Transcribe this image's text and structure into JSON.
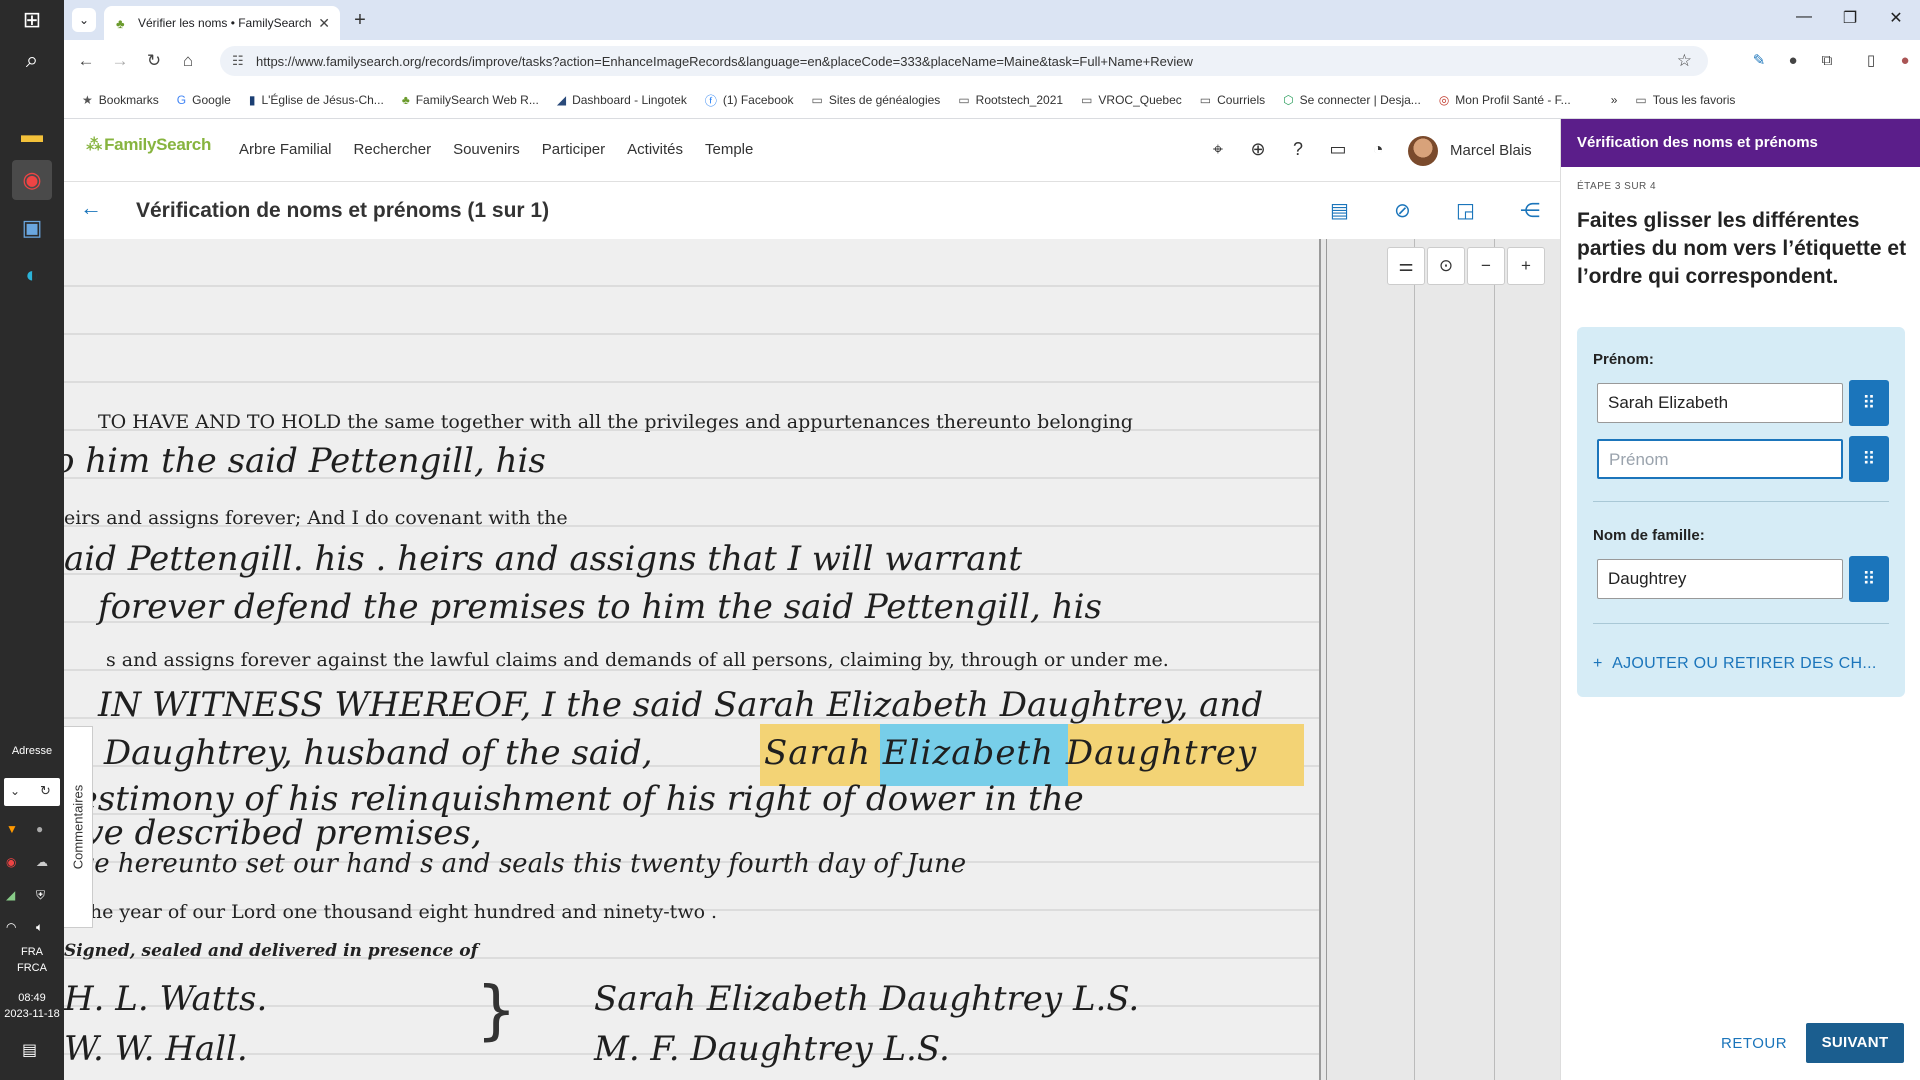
{
  "taskbar": {
    "adresse_label": "Adresse",
    "lang_top": "FRA",
    "lang_bottom": "FRCA",
    "time": "08:49",
    "date": "2023-11-18"
  },
  "browser": {
    "tab_title": "Vérifier les noms • FamilySearch",
    "url": "https://www.familysearch.org/records/improve/tasks?action=EnhanceImageRecords&language=en&placeCode=333&placeName=Maine&task=Full+Name+Review",
    "bookmarks": [
      {
        "label": "Bookmarks",
        "icon": "star"
      },
      {
        "label": "Google",
        "icon": "G"
      },
      {
        "label": "L'Église de Jésus-Ch...",
        "icon": "▮"
      },
      {
        "label": "FamilySearch Web R...",
        "icon": "♧"
      },
      {
        "label": "Dashboard - Lingotek",
        "icon": "◢"
      },
      {
        "label": "(1) Facebook",
        "icon": "f"
      },
      {
        "label": "Sites de généalogies",
        "icon": "folder"
      },
      {
        "label": "Rootstech_2021",
        "icon": "folder"
      },
      {
        "label": "VROC_Quebec",
        "icon": "folder"
      },
      {
        "label": "Courriels",
        "icon": "folder"
      },
      {
        "label": "Se connecter | Desja...",
        "icon": "⬡"
      },
      {
        "label": "Mon Profil Santé - F...",
        "icon": "◎"
      }
    ],
    "overflow": "»",
    "all_bookmarks": "Tous les favoris"
  },
  "fs": {
    "logo": "FamilySearch",
    "nav": [
      "Arbre Familial",
      "Rechercher",
      "Souvenirs",
      "Participer",
      "Activités",
      "Temple"
    ],
    "user": "Marcel Blais",
    "title": "Vérification de noms et prénoms (1 sur 1)",
    "comments": "Commentaires"
  },
  "record": {
    "lines": [
      "TO HAVE AND TO HOLD the same together with all the privileges and appurtenances thereunto belonging",
      "o  him  the said                    Pettengill,  his",
      "eirs and assigns forever;                                                                 And  I   do covenant with the",
      "aid              Pettengill.   his .          heirs and assigns that  I   will warrant",
      "forever defend the premises to  him  the said              Pettengill,  his",
      "s and assigns forever against the lawful claims and demands of all persons, claiming by, through or under me.",
      "IN WITNESS WHEREOF,   I     the said  Sarah Elizabeth Daughtrey,  and",
      "F. Daughtrey, husband of the said,",
      "testimony of his relinquishment of his right of dower in the",
      "ove described premises,",
      "ave hereunto set  our   hand s  and seals  this  twenty fourth   day of   June",
      "n the year of our Lord one thousand eight hundred and ninety-two .",
      "Signed, sealed and delivered in presence of",
      "H. L. Watts.",
      "W. W. Hall."
    ],
    "highlight_words": [
      "Sarah",
      "Elizabeth",
      "Daughtrey"
    ],
    "signatures": [
      "Sarah Elizabeth Daughtrey  L.S.",
      "M. F. Daughtrey  L.S."
    ]
  },
  "panel": {
    "header": "Vérification des noms et prénoms",
    "step": "ÉTAPE 3 SUR 4",
    "instruction": "Faites glisser les différentes parties du nom vers l’étiquette et l’ordre qui correspondent.",
    "given_label": "Prénom:",
    "given_value": "Sarah Elizabeth",
    "given_placeholder": "Prénom",
    "surname_label": "Nom de famille:",
    "surname_value": "Daughtrey",
    "add_remove": "AJOUTER OU RETIRER DES CH...",
    "back": "RETOUR",
    "next": "SUIVANT"
  },
  "colors": {
    "purple": "#5b1e8a",
    "blue": "#1b75bb",
    "panel_bg": "#d6ecf6",
    "highlight_yellow": "#f7d36a",
    "highlight_blue": "#6fd0ee"
  }
}
